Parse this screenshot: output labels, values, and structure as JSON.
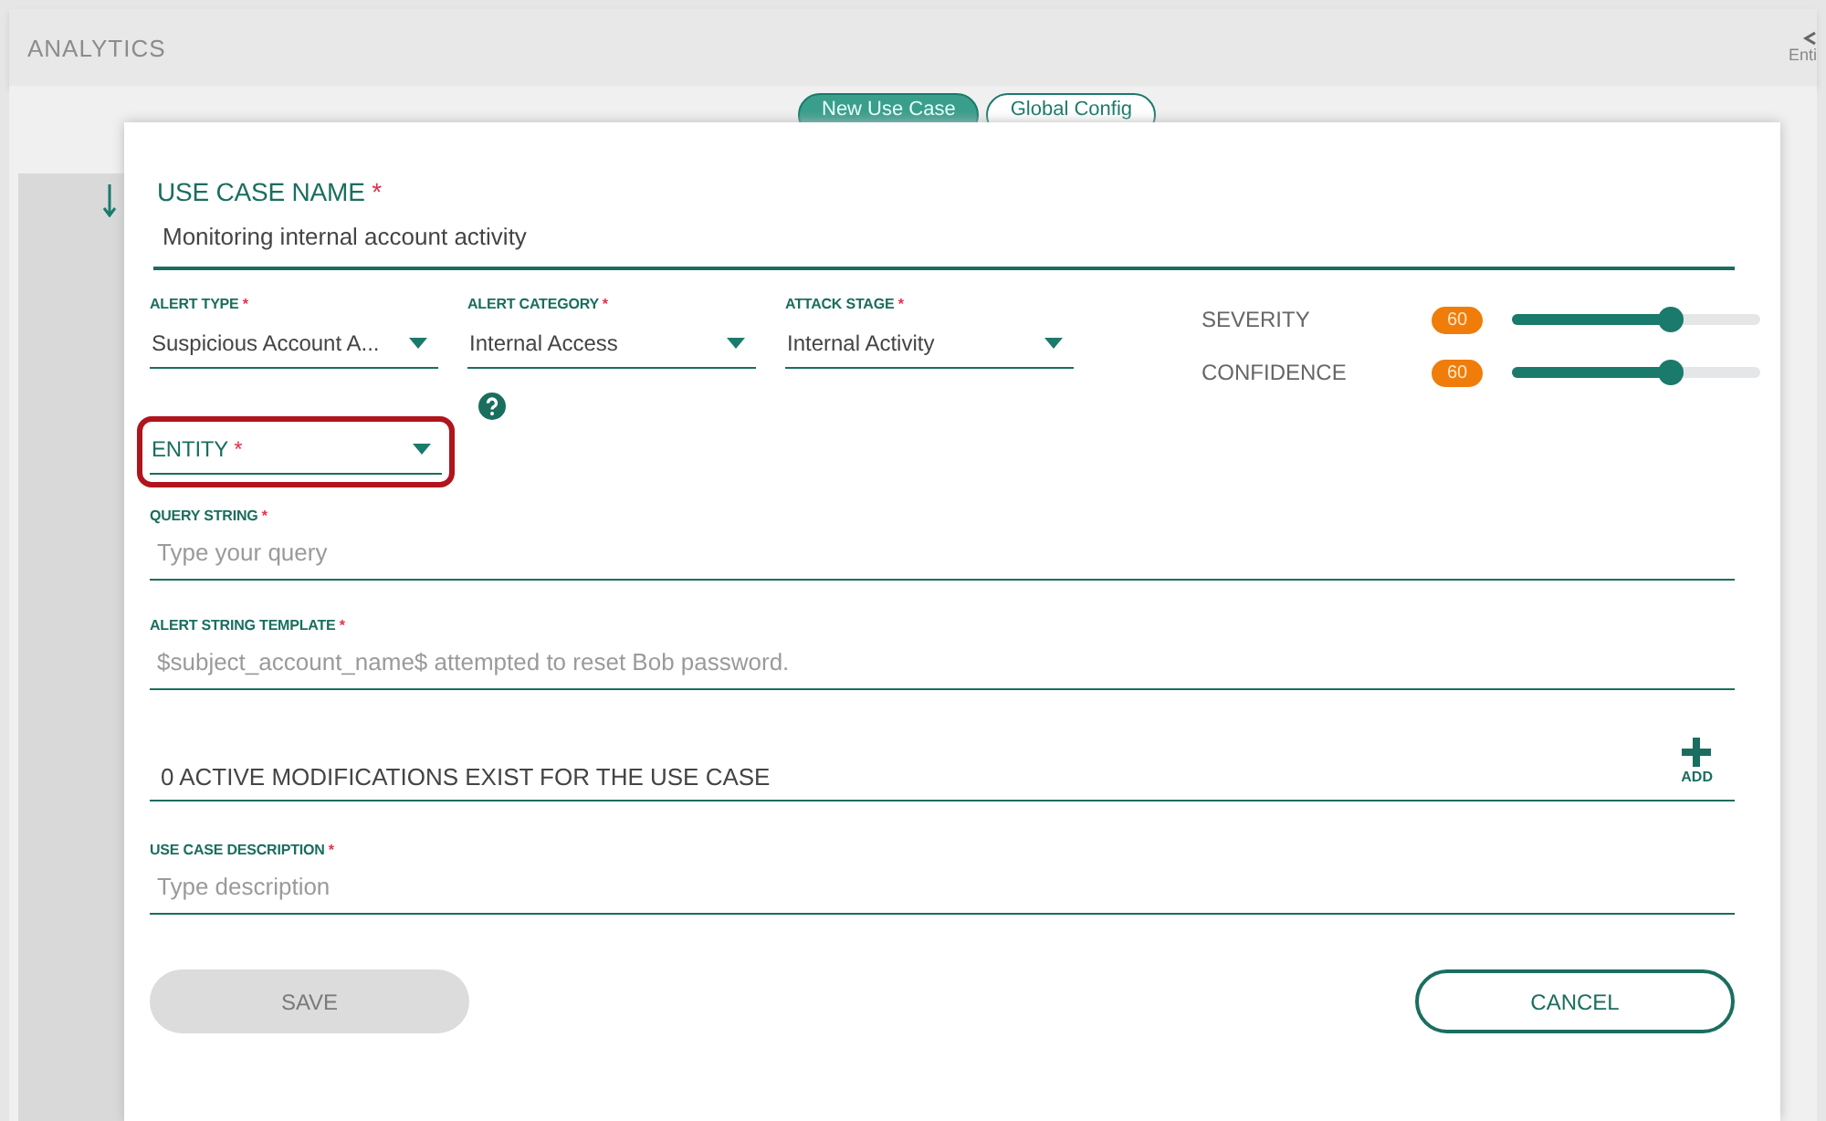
{
  "app_header": {
    "title": "ANALYTICS",
    "right_label": "Enti"
  },
  "tabs": [
    {
      "label": "New Use Case",
      "selected": true
    },
    {
      "label": "Global Config",
      "selected": false
    }
  ],
  "form": {
    "use_case_name": {
      "label": "USE CASE NAME",
      "required_mark": "*",
      "value": "Monitoring internal account activity"
    },
    "dropdowns": [
      {
        "label": "ALERT TYPE",
        "required_mark": "*",
        "value": "Suspicious Account A..."
      },
      {
        "label": "ALERT CATEGORY",
        "required_mark": "*",
        "value": "Internal Access"
      },
      {
        "label": "ATTACK STAGE",
        "required_mark": "*",
        "value": "Internal Activity"
      }
    ],
    "sliders": [
      {
        "label": "SEVERITY",
        "reading": "60",
        "level": 0.64
      },
      {
        "label": "CONFIDENCE",
        "reading": "60",
        "level": 0.64
      }
    ],
    "entity": {
      "label": "ENTITY",
      "required_mark": "*",
      "highlighted": true
    },
    "query_string": {
      "label": "QUERY STRING",
      "required_mark": "*",
      "placeholder": "Type your query"
    },
    "alert_string_template": {
      "label": "ALERT STRING TEMPLATE",
      "required_mark": "*",
      "placeholder": "$subject_account_name$ attempted to reset Bob password."
    },
    "modifications": {
      "text": "0 ACTIVE MODIFICATIONS EXIST FOR THE USE CASE",
      "add_label": "ADD"
    },
    "description": {
      "label": "USE CASE DESCRIPTION",
      "required_mark": "*",
      "placeholder": "Type description"
    }
  },
  "buttons": [
    {
      "label": "SAVE",
      "kind": "save",
      "disabled": true
    },
    {
      "label": "CANCEL",
      "kind": "cancel",
      "disabled": false
    }
  ]
}
